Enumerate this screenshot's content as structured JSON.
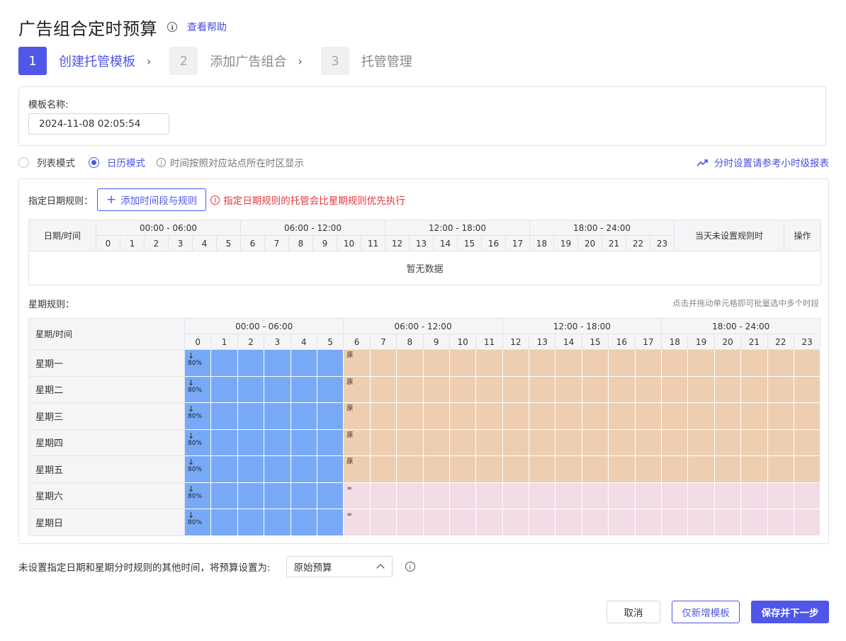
{
  "header": {
    "title": "广告组合定时预算",
    "help_link": "查看帮助"
  },
  "steps": [
    {
      "num": "1",
      "label": "创建托管模板",
      "active": true
    },
    {
      "num": "2",
      "label": "添加广告组合",
      "active": false
    },
    {
      "num": "3",
      "label": "托管管理",
      "active": false
    }
  ],
  "template_name": {
    "label": "模板名称:",
    "value": "2024-11-08 02:05:54"
  },
  "mode": {
    "list_label": "列表模式",
    "calendar_label": "日历模式",
    "selected": "calendar",
    "timezone_note": "时间按照对应站点所在时区显示",
    "report_link": "分时设置请参考小时级报表"
  },
  "date_rules": {
    "label": "指定日期规则：",
    "add_button": "添加时间段与规则",
    "warning": "指定日期规则的托管会比星期规则优先执行",
    "col_date": "日期/时间",
    "col_unset": "当天未设置规则时",
    "col_action": "操作",
    "empty_text": "暂无数据"
  },
  "time_groups": [
    "00:00 - 06:00",
    "06:00 - 12:00",
    "12:00 - 18:00",
    "18:00 - 24:00"
  ],
  "hours": [
    "0",
    "1",
    "2",
    "3",
    "4",
    "5",
    "6",
    "7",
    "8",
    "9",
    "10",
    "11",
    "12",
    "13",
    "14",
    "15",
    "16",
    "17",
    "18",
    "19",
    "20",
    "21",
    "22",
    "23"
  ],
  "week_rules": {
    "label": "星期规则：",
    "hint": "点击并拖动单元格即可批量选中多个时段",
    "col_day": "星期/时间",
    "days": [
      {
        "name": "星期一",
        "segments": [
          {
            "start": 0,
            "end": 6,
            "color": "blue",
            "label": "80%",
            "arrow": "↓"
          },
          {
            "start": 6,
            "end": 24,
            "color": "orange",
            "label": "原"
          }
        ]
      },
      {
        "name": "星期二",
        "segments": [
          {
            "start": 0,
            "end": 6,
            "color": "blue",
            "label": "80%",
            "arrow": "↓"
          },
          {
            "start": 6,
            "end": 24,
            "color": "orange",
            "label": "原"
          }
        ]
      },
      {
        "name": "星期三",
        "segments": [
          {
            "start": 0,
            "end": 6,
            "color": "blue",
            "label": "80%",
            "arrow": "↓"
          },
          {
            "start": 6,
            "end": 24,
            "color": "orange",
            "label": "原"
          }
        ]
      },
      {
        "name": "星期四",
        "segments": [
          {
            "start": 0,
            "end": 6,
            "color": "blue",
            "label": "80%",
            "arrow": "↓"
          },
          {
            "start": 6,
            "end": 24,
            "color": "orange",
            "label": "原"
          }
        ]
      },
      {
        "name": "星期五",
        "segments": [
          {
            "start": 0,
            "end": 6,
            "color": "blue",
            "label": "80%",
            "arrow": "↓"
          },
          {
            "start": 6,
            "end": 24,
            "color": "orange",
            "label": "原"
          }
        ]
      },
      {
        "name": "星期六",
        "segments": [
          {
            "start": 0,
            "end": 6,
            "color": "blue",
            "label": "80%",
            "arrow": "↓"
          },
          {
            "start": 6,
            "end": 24,
            "color": "pink",
            "label": "∞"
          }
        ]
      },
      {
        "name": "星期日",
        "segments": [
          {
            "start": 0,
            "end": 6,
            "color": "blue",
            "label": "80%",
            "arrow": "↓"
          },
          {
            "start": 6,
            "end": 24,
            "color": "pink",
            "label": "∞"
          }
        ]
      }
    ]
  },
  "fallback": {
    "text": "未设置指定日期和星期分时规则的其他时间，将预算设置为:",
    "selected": "原始预算"
  },
  "footer": {
    "cancel": "取消",
    "template_only": "仅新增模板",
    "save_next": "保存并下一步"
  },
  "colors": {
    "accent": "#4f56e8",
    "blue_slot": "#78a9f7",
    "orange_slot": "#eeceb0",
    "pink_slot": "#f2dce6",
    "warning": "#e0393e"
  }
}
